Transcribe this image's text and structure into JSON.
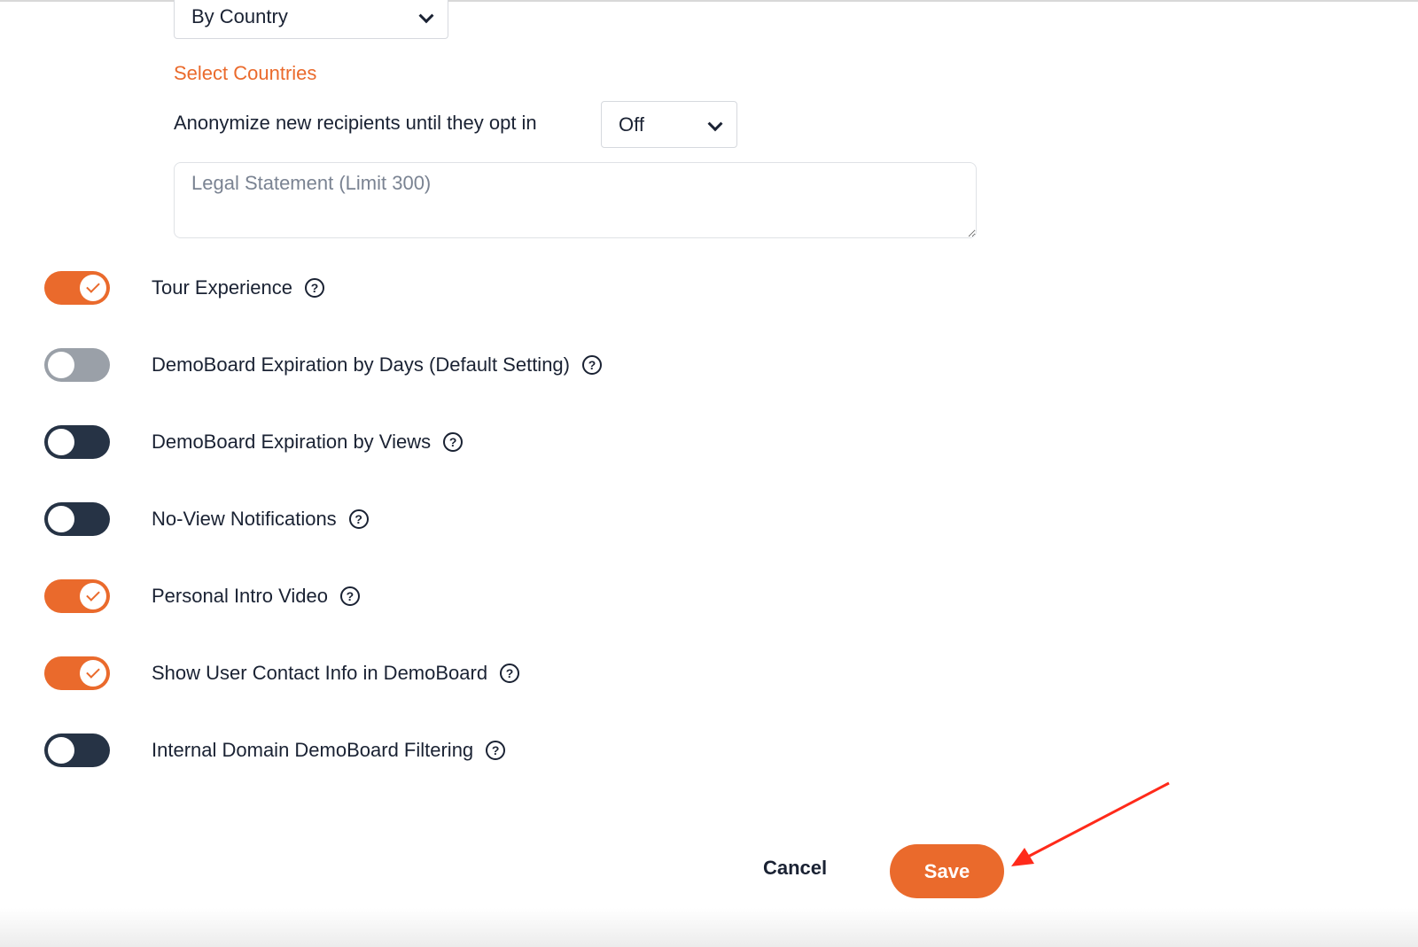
{
  "region_select": {
    "value": "By Country"
  },
  "select_countries_link": "Select Countries",
  "anonymize": {
    "label": "Anonymize new recipients until they opt in",
    "value": "Off"
  },
  "legal_statement": {
    "placeholder": "Legal Statement (Limit 300)",
    "value": ""
  },
  "toggles": [
    {
      "label": "Tour Experience",
      "state": "on"
    },
    {
      "label": "DemoBoard Expiration by Days (Default Setting)",
      "state": "off-disabled"
    },
    {
      "label": "DemoBoard Expiration by Views",
      "state": "off"
    },
    {
      "label": "No-View Notifications",
      "state": "off"
    },
    {
      "label": "Personal Intro Video",
      "state": "on"
    },
    {
      "label": "Show User Contact Info in DemoBoard",
      "state": "on"
    },
    {
      "label": "Internal Domain DemoBoard Filtering",
      "state": "off"
    }
  ],
  "help_glyph": "?",
  "actions": {
    "cancel": "Cancel",
    "save": "Save"
  },
  "colors": {
    "accent": "#ea6a2c",
    "dark": "#263345",
    "annotation": "#ff2a1a"
  }
}
